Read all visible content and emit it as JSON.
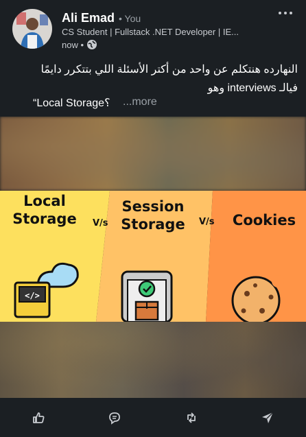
{
  "author": {
    "name": "Ali Emad",
    "relation": "• You",
    "headline": "CS Student | Fullstack .NET Developer | IE...",
    "time": "now •"
  },
  "post": {
    "line1": "النهارده هنتكلم عن واحد من أكتر الأسئلة اللي بتتكرر دايمًا",
    "line2": "فيالـ interviews وهو",
    "line3": "“Local Storage؟",
    "see_more": "...more"
  },
  "image": {
    "panel1": "Local\nStorage",
    "vs1": "V/s",
    "panel2": "Session\nStorage",
    "vs2": "V/s",
    "panel3": "Cookies",
    "colors": {
      "panel1": "#fde05e",
      "panel2": "#ffc266",
      "panel3": "#ff9447"
    }
  },
  "actions": [
    {
      "icon": "like-icon"
    },
    {
      "icon": "comment-icon"
    },
    {
      "icon": "repost-icon"
    },
    {
      "icon": "send-icon"
    }
  ],
  "theme": {
    "background": "#1b1f23",
    "muted": "#9aa0a6"
  }
}
